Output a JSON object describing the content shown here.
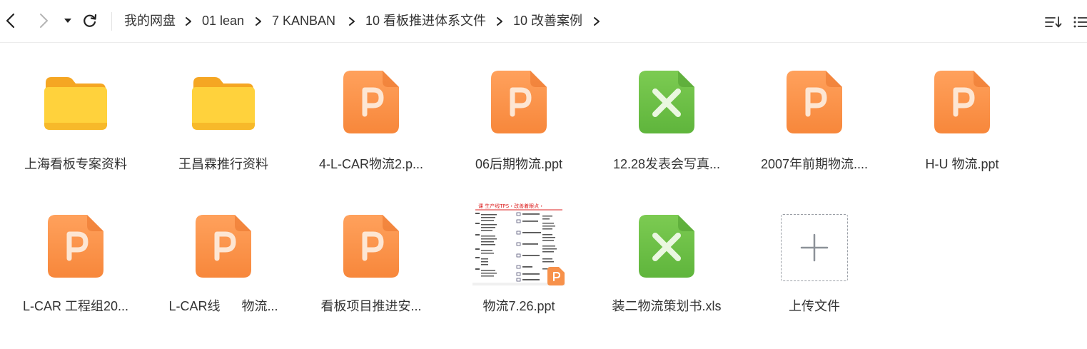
{
  "breadcrumb": {
    "items": [
      "我的网盘",
      "01 lean",
      "7 KANBAN",
      "10 看板推进体系文件",
      "10 改善案例"
    ]
  },
  "toolbar": {
    "back_icon": "chevron-left-icon",
    "forward_icon": "chevron-right-icon",
    "history_icon": "caret-down-icon",
    "refresh_icon": "refresh-icon",
    "sort_icon": "sort-icon",
    "view_icon": "list-view-icon"
  },
  "files": [
    {
      "name": "上海看板专案资料",
      "type": "folder"
    },
    {
      "name": "王昌霖推行资料",
      "type": "folder"
    },
    {
      "name": "4-L-CAR物流2.p...",
      "type": "ppt"
    },
    {
      "name": "06后期物流.ppt",
      "type": "ppt"
    },
    {
      "name": "12.28发表会写真...",
      "type": "xls"
    },
    {
      "name": "2007年前期物流....",
      "type": "ppt"
    },
    {
      "name": "H-U   物流.ppt",
      "type": "ppt"
    },
    {
      "name": "L-CAR 工程组20...",
      "type": "ppt"
    },
    {
      "name": "L-CAR线      物流...",
      "type": "ppt"
    },
    {
      "name": "看板项目推进安...",
      "type": "ppt"
    },
    {
      "name": "物流7.26.ppt",
      "type": "ppt-thumb"
    },
    {
      "name": "装二物流策划书.xls",
      "type": "xls"
    },
    {
      "name": "上传文件",
      "type": "upload"
    }
  ],
  "thumb": {
    "title": "课      生产线TPS・改善着眼点・",
    "badge": "P"
  },
  "colors": {
    "ppt": "#f7914a",
    "xls": "#6cc04a",
    "folder": "#ffc928"
  }
}
